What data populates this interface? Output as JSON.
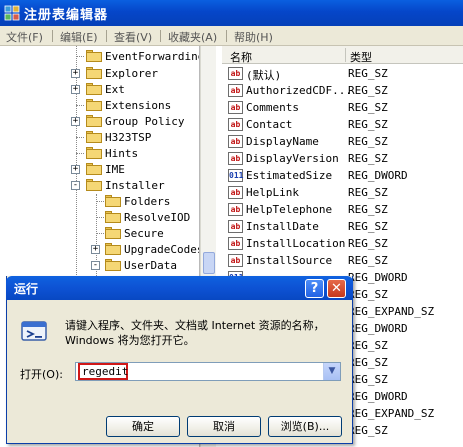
{
  "app": {
    "title": "注册表编辑器",
    "colors": {
      "titlebar": "#0546c9",
      "selection": "#316ac5",
      "accent_red": "#d01818"
    }
  },
  "menu": [
    {
      "label": "文件(F)",
      "icon": "none"
    },
    {
      "label": "编辑(E)",
      "icon": "none"
    },
    {
      "label": "查看(V)",
      "icon": "none"
    },
    {
      "label": "收藏夹(A)",
      "icon": "none"
    },
    {
      "label": "帮助(H)",
      "icon": "none"
    }
  ],
  "tree": {
    "items": [
      {
        "label": "EventForwarding",
        "expander": ""
      },
      {
        "label": "Explorer",
        "expander": "+"
      },
      {
        "label": "Ext",
        "expander": "+"
      },
      {
        "label": "Extensions",
        "expander": ""
      },
      {
        "label": "Group Policy",
        "expander": "+"
      },
      {
        "label": "H323TSP",
        "expander": ""
      },
      {
        "label": "Hints",
        "expander": ""
      },
      {
        "label": "IME",
        "expander": "+"
      },
      {
        "label": "Installer",
        "expander": "-"
      },
      {
        "label": "Folders",
        "expander": ""
      },
      {
        "label": "ResolveIOD",
        "expander": ""
      },
      {
        "label": "Secure",
        "expander": ""
      },
      {
        "label": "UpgradeCodes",
        "expander": "+"
      },
      {
        "label": "UserData",
        "expander": "-"
      }
    ]
  },
  "list": {
    "headers": {
      "name": "名称",
      "type": "类型"
    },
    "rows": [
      {
        "name": "(默认)",
        "type": "REG_SZ",
        "icon": "ab"
      },
      {
        "name": "AuthorizedCDF...",
        "type": "REG_SZ",
        "icon": "ab"
      },
      {
        "name": "Comments",
        "type": "REG_SZ",
        "icon": "ab"
      },
      {
        "name": "Contact",
        "type": "REG_SZ",
        "icon": "ab"
      },
      {
        "name": "DisplayName",
        "type": "REG_SZ",
        "icon": "ab"
      },
      {
        "name": "DisplayVersion",
        "type": "REG_SZ",
        "icon": "ab"
      },
      {
        "name": "EstimatedSize",
        "type": "REG_DWORD",
        "icon": "bin"
      },
      {
        "name": "HelpLink",
        "type": "REG_SZ",
        "icon": "ab"
      },
      {
        "name": "HelpTelephone",
        "type": "REG_SZ",
        "icon": "ab"
      },
      {
        "name": "InstallDate",
        "type": "REG_SZ",
        "icon": "ab"
      },
      {
        "name": "InstallLocation",
        "type": "REG_SZ",
        "icon": "ab"
      },
      {
        "name": "InstallSource",
        "type": "REG_SZ",
        "icon": "ab"
      },
      {
        "name": "",
        "type": "REG_DWORD",
        "icon": "bin"
      },
      {
        "name": "",
        "type": "REG_SZ",
        "icon": "ab"
      },
      {
        "name": "",
        "type": "REG_EXPAND_SZ",
        "icon": "ab"
      },
      {
        "name": "",
        "type": "REG_DWORD",
        "icon": "bin"
      },
      {
        "name": "",
        "type": "REG_SZ",
        "icon": "ab"
      },
      {
        "name": "",
        "type": "REG_SZ",
        "icon": "ab"
      },
      {
        "name": "",
        "type": "REG_SZ",
        "icon": "ab"
      },
      {
        "name": "",
        "type": "REG_DWORD",
        "icon": "bin"
      },
      {
        "name": "",
        "type": "REG_EXPAND_SZ",
        "icon": "ab"
      },
      {
        "name": "",
        "type": "REG_SZ",
        "icon": "ab"
      }
    ]
  },
  "run_dialog": {
    "title": "运行",
    "help_label": "?",
    "close_label": "✕",
    "message": "请键入程序、文件夹、文档或 Internet 资源的名称，Windows 将为您打开它。",
    "open_label": "打开(O):",
    "input_value": "regedit",
    "buttons": {
      "ok": "确定",
      "cancel": "取消",
      "browse": "浏览(B)..."
    }
  }
}
